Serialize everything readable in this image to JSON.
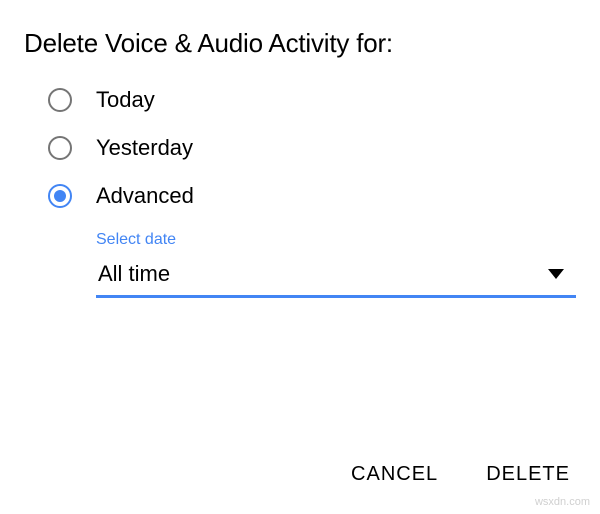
{
  "dialog": {
    "title": "Delete Voice & Audio Activity for:"
  },
  "options": {
    "today": {
      "label": "Today",
      "selected": false
    },
    "yesterday": {
      "label": "Yesterday",
      "selected": false
    },
    "advanced": {
      "label": "Advanced",
      "selected": true
    }
  },
  "date_select": {
    "label": "Select date",
    "value": "All time"
  },
  "actions": {
    "cancel": "CANCEL",
    "delete": "DELETE"
  },
  "watermark": "wsxdn.com"
}
